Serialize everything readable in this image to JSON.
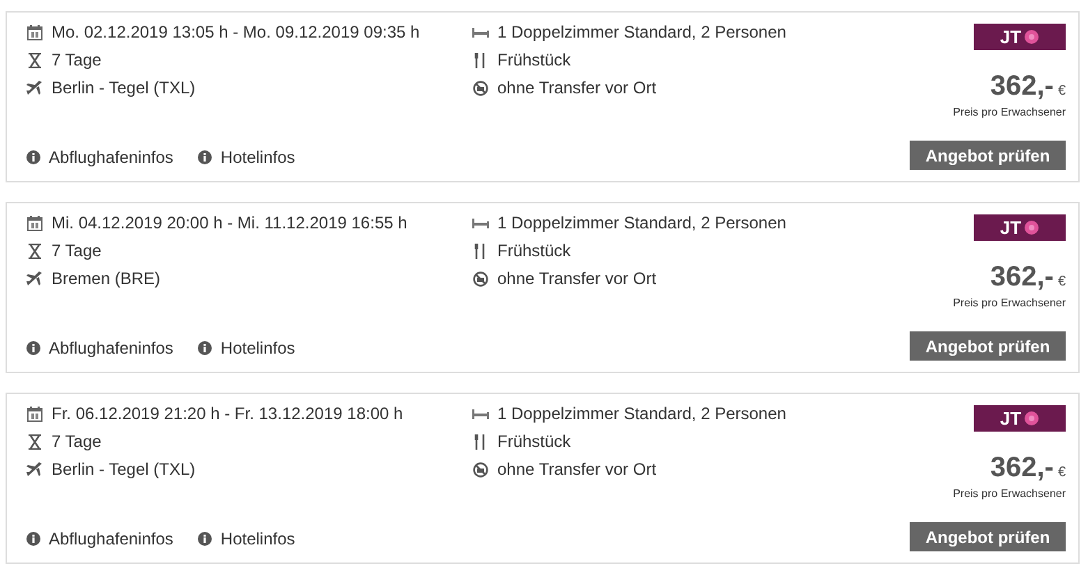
{
  "offers": [
    {
      "dates": "Mo. 02.12.2019 13:05 h - Mo. 09.12.2019 09:35 h",
      "duration": "7 Tage",
      "departure": "Berlin - Tegel (TXL)",
      "room": "1 Doppelzimmer Standard, 2 Personen",
      "board": "Frühstück",
      "transfer": "ohne Transfer vor Ort",
      "operator": "JT",
      "price": "362,-",
      "currency": "€",
      "price_note": "Preis pro Erwachsener",
      "button": "Angebot prüfen",
      "links": [
        "Abflughafeninfos",
        "Hotelinfos"
      ]
    },
    {
      "dates": "Mi. 04.12.2019 20:00 h - Mi. 11.12.2019 16:55 h",
      "duration": "7 Tage",
      "departure": "Bremen (BRE)",
      "room": "1 Doppelzimmer Standard, 2 Personen",
      "board": "Frühstück",
      "transfer": "ohne Transfer vor Ort",
      "operator": "JT",
      "price": "362,-",
      "currency": "€",
      "price_note": "Preis pro Erwachsener",
      "button": "Angebot prüfen",
      "links": [
        "Abflughafeninfos",
        "Hotelinfos"
      ]
    },
    {
      "dates": "Fr. 06.12.2019 21:20 h - Fr. 13.12.2019 18:00 h",
      "duration": "7 Tage",
      "departure": "Berlin - Tegel (TXL)",
      "room": "1 Doppelzimmer Standard, 2 Personen",
      "board": "Frühstück",
      "transfer": "ohne Transfer vor Ort",
      "operator": "JT",
      "price": "362,-",
      "currency": "€",
      "price_note": "Preis pro Erwachsener",
      "button": "Angebot prüfen",
      "links": [
        "Abflughafeninfos",
        "Hotelinfos"
      ]
    }
  ]
}
